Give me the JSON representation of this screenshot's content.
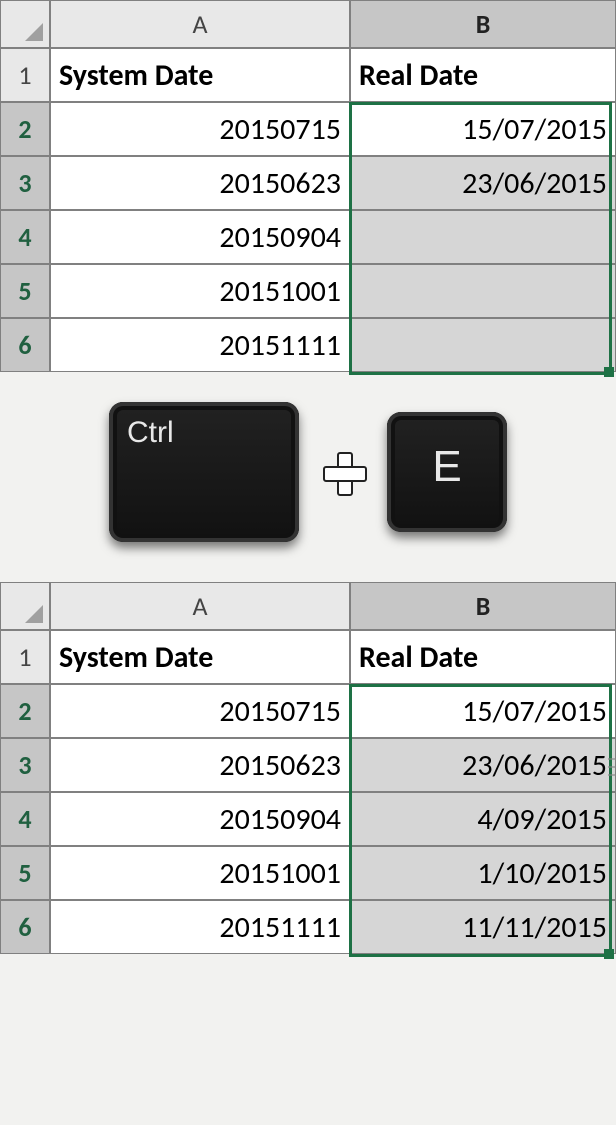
{
  "top": {
    "columns": {
      "A": "A",
      "B": "B"
    },
    "rowLabels": [
      "1",
      "2",
      "3",
      "4",
      "5",
      "6"
    ],
    "headers": {
      "A": "System Date",
      "B": "Real Date"
    },
    "rows": [
      {
        "A": "20150715",
        "B": "15/07/2015"
      },
      {
        "A": "20150623",
        "B": "23/06/2015"
      },
      {
        "A": "20150904",
        "B": ""
      },
      {
        "A": "20151001",
        "B": ""
      },
      {
        "A": "20151111",
        "B": ""
      }
    ],
    "selectedColumn": "B",
    "selectedRowStart": 2,
    "selectedRowEnd": 6
  },
  "shortcut": {
    "key1": "Ctrl",
    "key2": "E"
  },
  "bottom": {
    "columns": {
      "A": "A",
      "B": "B"
    },
    "rowLabels": [
      "1",
      "2",
      "3",
      "4",
      "5",
      "6"
    ],
    "headers": {
      "A": "System Date",
      "B": "Real Date"
    },
    "rows": [
      {
        "A": "20150715",
        "B": "15/07/2015"
      },
      {
        "A": "20150623",
        "B": "23/06/2015"
      },
      {
        "A": "20150904",
        "B": "4/09/2015"
      },
      {
        "A": "20151001",
        "B": "1/10/2015"
      },
      {
        "A": "20151111",
        "B": "11/11/2015"
      }
    ],
    "selectedColumn": "B",
    "selectedRowStart": 2,
    "selectedRowEnd": 6,
    "flashFillIconRow": 3
  },
  "colors": {
    "selection": "#1e7145",
    "rowSelText": "#206040"
  }
}
